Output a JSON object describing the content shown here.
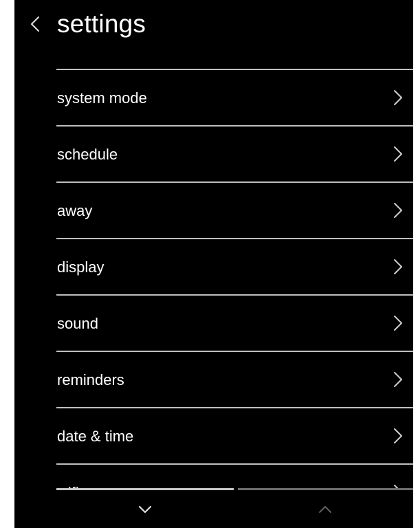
{
  "header": {
    "title": "settings",
    "back_icon": "chevron-left-icon"
  },
  "menu": {
    "items": [
      {
        "label": "system mode",
        "icon": "chevron-right-icon"
      },
      {
        "label": "schedule",
        "icon": "chevron-right-icon"
      },
      {
        "label": "away",
        "icon": "chevron-right-icon"
      },
      {
        "label": "display",
        "icon": "chevron-right-icon"
      },
      {
        "label": "sound",
        "icon": "chevron-right-icon"
      },
      {
        "label": "reminders",
        "icon": "chevron-right-icon"
      },
      {
        "label": "date & time",
        "icon": "chevron-right-icon"
      },
      {
        "label": "wifi",
        "icon": "chevron-right-icon"
      }
    ]
  },
  "footer": {
    "scroll_down_icon": "chevron-down-icon",
    "scroll_up_icon": "chevron-up-icon",
    "scroll_up_state": "disabled"
  },
  "colors": {
    "background": "#000000",
    "text": "#ffffff",
    "divider": "#bfbfbf",
    "icon": "#cfcfcf",
    "icon_disabled": "#6e6e6e"
  }
}
